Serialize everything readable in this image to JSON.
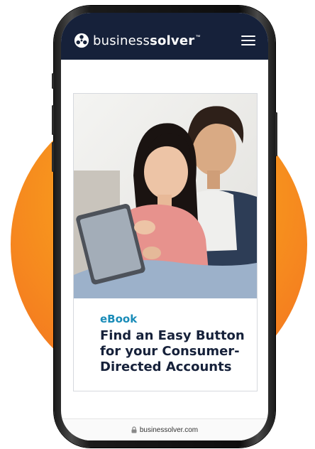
{
  "header": {
    "logo_text_light": "business",
    "logo_text_bold": "solver",
    "trademark": "™",
    "logo_icon": "businessolver-logo-icon",
    "menu_icon": "hamburger-menu-icon",
    "background_color": "#16213a"
  },
  "card": {
    "eyebrow": "eBook",
    "title": "Find an Easy Button for your Consumer-Directed Accounts",
    "image": "couple-reading-tablet-photo",
    "eyebrow_color": "#1a8cb8",
    "title_color": "#16213a"
  },
  "browser": {
    "url": "businessolver.com",
    "lock_icon": "lock-icon"
  },
  "colors": {
    "accent_orange": "#f7931e",
    "background": "#ffffff"
  }
}
